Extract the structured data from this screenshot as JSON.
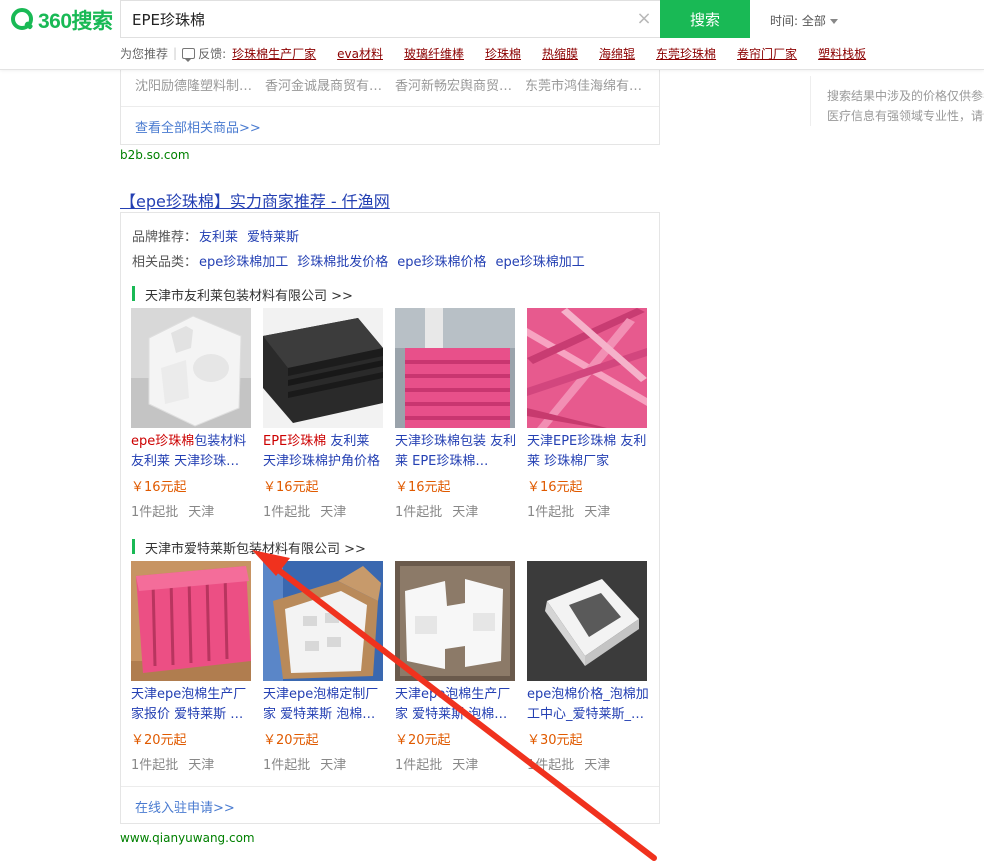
{
  "header": {
    "logo_text": "360搜索",
    "search_value": "EPE珍珠棉",
    "search_button": "搜索",
    "time_filter": "时间: 全部",
    "rec_label": "为您推荐",
    "feedback_label": "反馈:",
    "recommendations": [
      "珍珠棉生产厂家",
      "eva材料",
      "玻璃纤维棒",
      "珍珠棉",
      "热缩膜",
      "海绵辊",
      "东莞珍珠棉",
      "卷帘门厂家",
      "塑料栈板"
    ]
  },
  "sidebar": {
    "line1": "搜索结果中涉及的价格仅供参考",
    "line2": "医疗信息有强领域专业性，请谨慎甄别"
  },
  "b2b_card": {
    "companies": [
      "沈阳励德隆塑料制…",
      "香河金诚晟商贸有…",
      "香河新畅宏舆商贸…",
      "东莞市鸿佳海绵有…"
    ],
    "view_all": "查看全部相关商品>>",
    "source": "b2b.so.com"
  },
  "result": {
    "title": "【epe珍珠棉】实力商家推荐 - 仟渔网",
    "brand_label": "品牌推荐：",
    "brands": [
      "友利莱",
      "爱特莱斯"
    ],
    "category_label": "相关品类：",
    "categories": [
      "epe珍珠棉加工",
      "珍珠棉批发价格",
      "epe珍珠棉价格",
      "epe珍珠棉加工"
    ],
    "sections": [
      {
        "heading": "天津市友利莱包装材料有限公司 >>",
        "products": [
          {
            "title_hl": "epe珍珠棉",
            "title_rest": "包装材料友利莱 天津珍珠…",
            "price": "￥16元起",
            "moq": "1件起批",
            "location": "天津",
            "image": "white-foam-insert"
          },
          {
            "title_hl": "EPE珍珠棉",
            "title_rest": " 友利莱 天津珍珠棉护角价格",
            "price": "￥16元起",
            "moq": "1件起批",
            "location": "天津",
            "image": "black-foam-sheets"
          },
          {
            "title_hl": "",
            "title_rest": "天津珍珠棉包装 友利莱 EPE珍珠棉…",
            "price": "￥16元起",
            "moq": "1件起批",
            "location": "天津",
            "image": "pink-foam-factory"
          },
          {
            "title_hl": "",
            "title_rest": "天津EPE珍珠棉 友利莱 珍珠棉厂家",
            "price": "￥16元起",
            "moq": "1件起批",
            "location": "天津",
            "image": "pink-foam-strips"
          }
        ]
      },
      {
        "heading": "天津市爱特莱斯包装材料有限公司 >>",
        "products": [
          {
            "title_hl": "",
            "title_rest": "天津epe泡棉生产厂家报价 爱特莱斯 …",
            "price": "￥20元起",
            "moq": "1件起批",
            "location": "天津",
            "image": "pink-divider-box"
          },
          {
            "title_hl": "",
            "title_rest": "天津epe泡棉定制厂家 爱特莱斯 泡棉…",
            "price": "￥20元起",
            "moq": "1件起批",
            "location": "天津",
            "image": "carton-foam-insert"
          },
          {
            "title_hl": "",
            "title_rest": "天津epe泡棉生产厂家 爱特莱斯 泡棉…",
            "price": "￥20元起",
            "moq": "1件起批",
            "location": "天津",
            "image": "white-foam-blocks"
          },
          {
            "title_hl": "",
            "title_rest": "epe泡棉价格_泡棉加工中心_爱特莱斯_…",
            "price": "￥30元起",
            "moq": "1件起批",
            "location": "天津",
            "image": "white-foam-frame"
          }
        ]
      }
    ],
    "join_link": "在线入驻申请>>",
    "source": "www.qianyuwang.com"
  },
  "colors": {
    "brand_green": "#19b955",
    "link_blue": "#2440b3",
    "rec_red": "#8b0000",
    "price_orange": "#e05a00",
    "annotation_arrow": "#f0321e"
  },
  "icons": [
    "clear-icon",
    "feedback-icon",
    "dropdown-caret-icon"
  ]
}
